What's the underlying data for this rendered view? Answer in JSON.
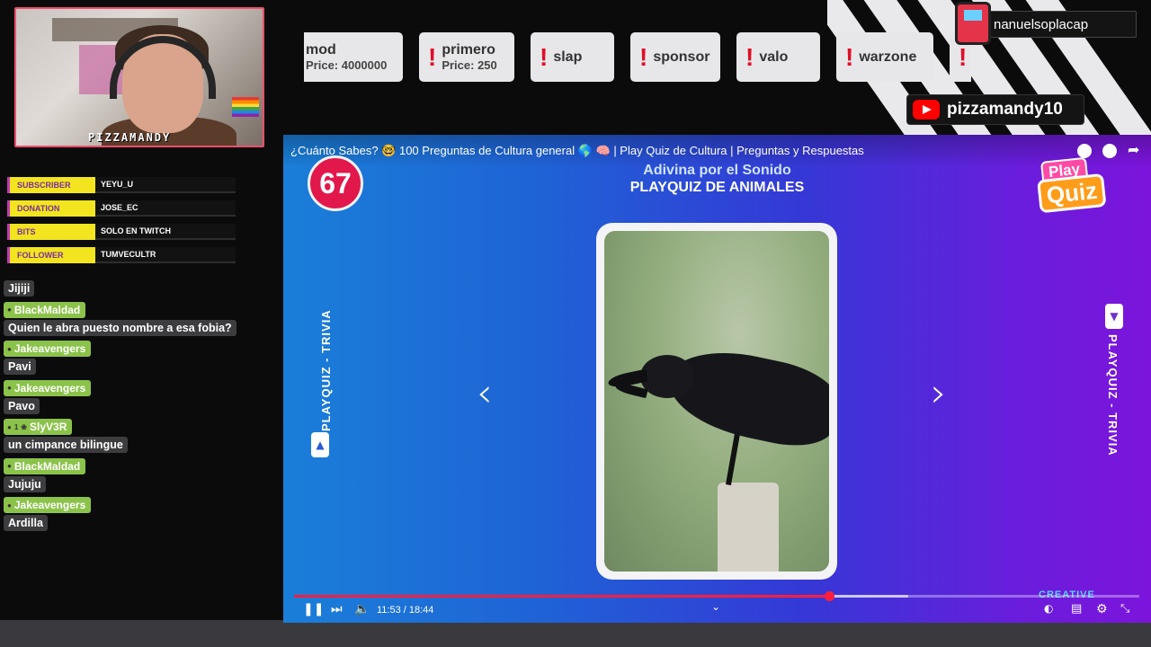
{
  "webcam": {
    "tagline": "PIZZAMANDY"
  },
  "alerts": [
    {
      "type": "SUBSCRIBER",
      "value": "YEYU_U"
    },
    {
      "type": "DONATION",
      "value": "JOSE_EC"
    },
    {
      "type": "BITS",
      "value": "SOLO EN TWITCH"
    },
    {
      "type": "FOLLOWER",
      "value": "TUMVECULTR"
    }
  ],
  "chat": [
    {
      "user": "",
      "message": "Jijiji"
    },
    {
      "user": "BlackMaldad",
      "message": "Quien le abra puesto nombre a esa fobia?"
    },
    {
      "user": "Jakeavengers",
      "message": "Pavi"
    },
    {
      "user": "Jakeavengers",
      "message": "Pavo"
    },
    {
      "user": "SlyV3R",
      "badge": "1",
      "message": "un cimpance bilingue"
    },
    {
      "user": "BlackMaldad",
      "message": "Jujuju"
    },
    {
      "user": "Jakeavengers",
      "message": "Ardilla"
    }
  ],
  "redeems": [
    {
      "name": "mod",
      "price": "Price: 4000000",
      "icon": "none"
    },
    {
      "name": "primero",
      "price": "Price: 250",
      "icon": "exclamation"
    },
    {
      "name": "slap",
      "price": "",
      "icon": "exclamation"
    },
    {
      "name": "sponsor",
      "price": "",
      "icon": "exclamation"
    },
    {
      "name": "valo",
      "price": "",
      "icon": "exclamation"
    },
    {
      "name": "warzone",
      "price": "",
      "icon": "exclamation"
    },
    {
      "name": "",
      "price": "",
      "icon": "exclamation"
    }
  ],
  "socials": {
    "twitch_handle": "nanuelsoplacap",
    "youtube_handle": "pizzamandy10"
  },
  "player": {
    "title": "¿Cuánto Sabes? 🤓 100 Preguntas de Cultura general 🌎 🧠 | Play Quiz de Cultura | Preguntas y Respuestas",
    "question_number": "67",
    "subheading": "Adivina por el Sonido",
    "heading": "PLAYQUIZ DE ANIMALES",
    "logo_top": "Play",
    "logo_bottom": "Quiz",
    "side_label": "PLAYQUIZ - TRIVIA",
    "time": "11:53 / 18:44",
    "progress": 0.633,
    "buffered": 0.727,
    "branding": "CREATIVE"
  }
}
